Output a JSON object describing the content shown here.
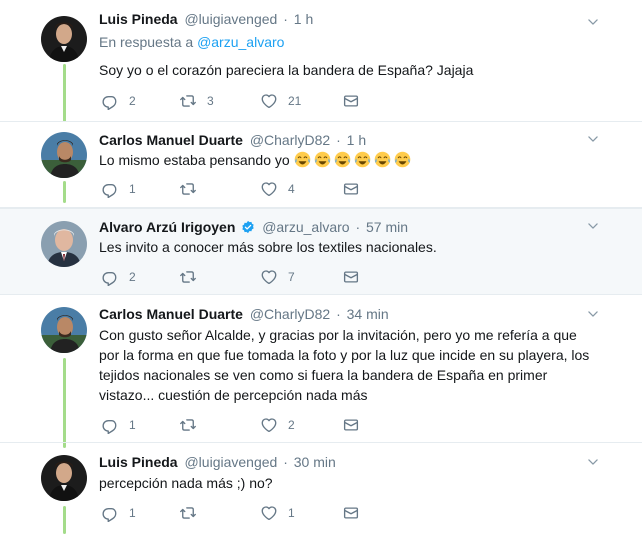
{
  "tweets": [
    {
      "fullname": "Luis Pineda",
      "username": "@luigiavenged",
      "time": "1 h",
      "reply_prefix": "En respuesta a",
      "reply_mention": "@arzu_alvaro",
      "text": "Soy yo o el corazón pareciera la bandera de España? Jajaja",
      "replies": "2",
      "retweets": "3",
      "likes": "21"
    },
    {
      "fullname": "Carlos Manuel Duarte",
      "username": "@CharlyD82",
      "time": "1 h",
      "text": "Lo mismo estaba pensando yo",
      "emoji_count": 6,
      "replies": "1",
      "retweets": "",
      "likes": "4"
    },
    {
      "fullname": "Alvaro Arzú Irigoyen",
      "username": "@arzu_alvaro",
      "time": "57 min",
      "verified": true,
      "text": "Les invito a conocer más sobre los textiles nacionales.",
      "replies": "2",
      "retweets": "",
      "likes": "7"
    },
    {
      "fullname": "Carlos Manuel Duarte",
      "username": "@CharlyD82",
      "time": "34 min",
      "text_lines": [
        "Con gusto señor Alcalde, y gracias por la invitación, pero yo me refería a que",
        "por la forma en que fue tomada la foto y por la luz que incide en su playera, los",
        "tejidos nacionales se ven como si fuera la bandera de España en primer",
        "vistazo... cuestión de percepción nada más"
      ],
      "replies": "1",
      "retweets": "",
      "likes": "2"
    },
    {
      "fullname": "Luis Pineda",
      "username": "@luigiavenged",
      "time": "30 min",
      "text": "percepción nada más ;) no?",
      "replies": "1",
      "retweets": "",
      "likes": "1"
    }
  ],
  "icons": {
    "reply": "reply-icon",
    "retweet": "retweet-icon",
    "like": "heart-icon",
    "dm": "envelope-icon",
    "caret": "chevron-down-icon",
    "verified": "verified-badge-icon",
    "emoji": "tears-of-joy-emoji"
  },
  "colors": {
    "link": "#1da1f2",
    "secondary": "#657786",
    "thread_line": "#a4dc8a",
    "highlight_bg": "#f5f8fa"
  }
}
